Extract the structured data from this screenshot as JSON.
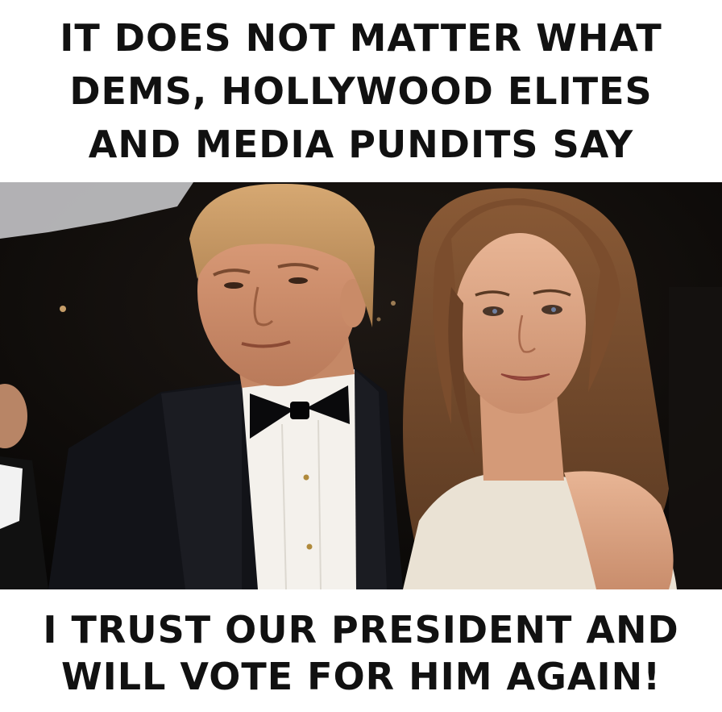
{
  "caption_top": {
    "lines": [
      "IT DOES NOT MATTER WHAT",
      "DEMS, HOLLYWOOD ELITES",
      "AND MEDIA PUNDITS SAY"
    ]
  },
  "caption_bottom": {
    "lines": [
      "I TRUST OUR PRESIDENT AND",
      "WILL VOTE FOR HIM AGAIN!"
    ]
  },
  "colors": {
    "background": "#ffffff",
    "text": "#111111",
    "photo_dark": "#0c0a09"
  }
}
